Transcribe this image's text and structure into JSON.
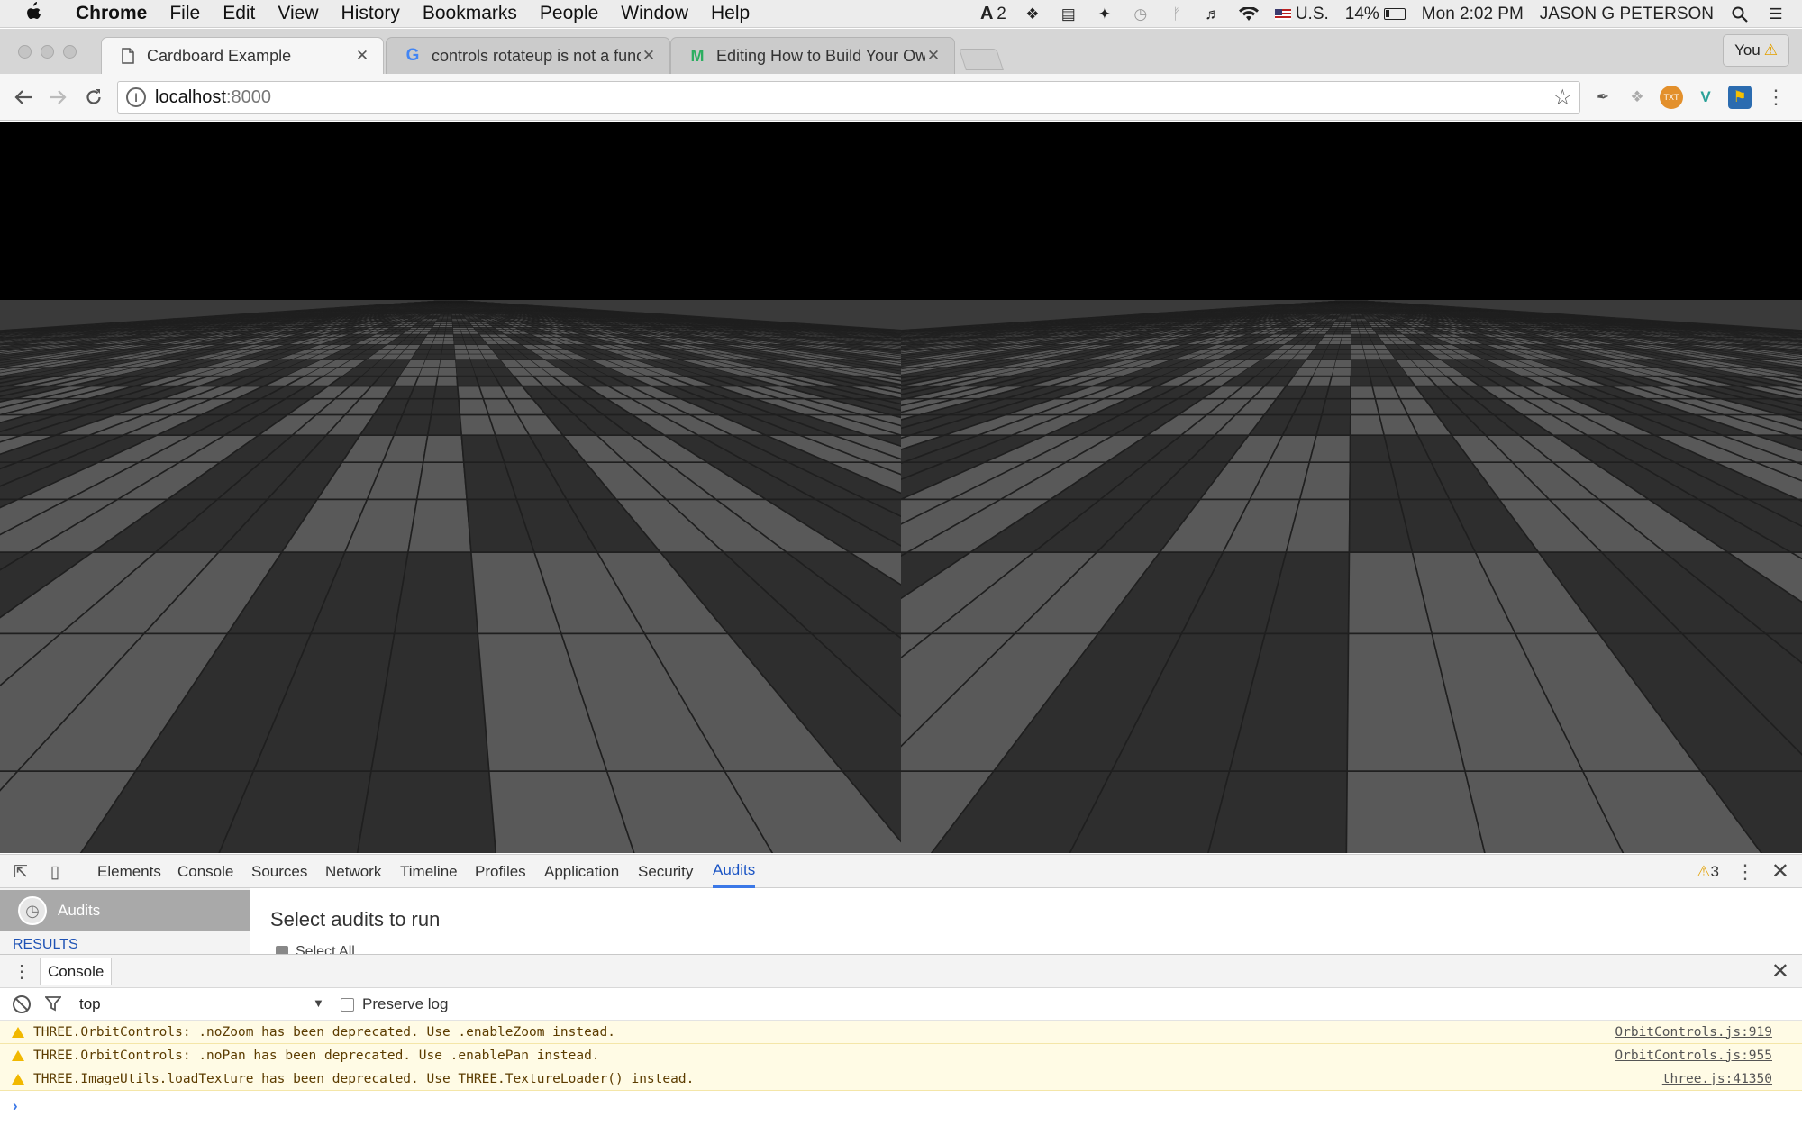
{
  "menubar": {
    "app": "Chrome",
    "items": [
      "File",
      "Edit",
      "View",
      "History",
      "Bookmarks",
      "People",
      "Window",
      "Help"
    ],
    "adobe_badge": "2",
    "input_source": "U.S.",
    "battery": "14%",
    "clock": "Mon 2:02 PM",
    "user": "JASON G PETERSON"
  },
  "tabs": [
    {
      "title": "Cardboard Example",
      "icon": "page-icon",
      "active": true
    },
    {
      "title": "controls rotateup is not a functi",
      "icon": "google-icon",
      "active": false
    },
    {
      "title": "Editing How to Build Your Own",
      "icon": "medium-icon",
      "active": false
    }
  ],
  "profile": {
    "label": "You"
  },
  "address": {
    "host": "localhost",
    "port": ":8000"
  },
  "colors": {
    "accent": "#3b78e7",
    "warning": "#f1b800",
    "tile_light": "#595959",
    "tile_dark": "#2e2e2e"
  },
  "devtools": {
    "tabs": [
      "Elements",
      "Console",
      "Sources",
      "Network",
      "Timeline",
      "Profiles",
      "Application",
      "Security",
      "Audits"
    ],
    "active_tab": "Audits",
    "warning_count": "3",
    "audits": {
      "sidebar_item": "Audits",
      "results_label": "RESULTS",
      "heading": "Select audits to run",
      "select_all": "Select All"
    },
    "drawer": {
      "tab": "Console",
      "context": "top",
      "preserve_log": "Preserve log",
      "messages": [
        {
          "text": "THREE.OrbitControls: .noZoom has been deprecated. Use .enableZoom instead.",
          "source": "OrbitControls.js:919"
        },
        {
          "text": "THREE.OrbitControls: .noPan has been deprecated. Use .enablePan instead.",
          "source": "OrbitControls.js:955"
        },
        {
          "text": "THREE.ImageUtils.loadTexture has been deprecated. Use THREE.TextureLoader() instead.",
          "source": "three.js:41350"
        }
      ],
      "prompt": "›"
    }
  }
}
